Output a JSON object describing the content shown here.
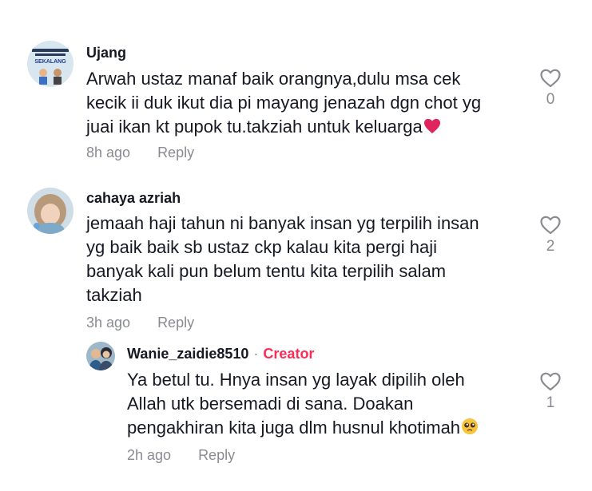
{
  "comments": [
    {
      "username": "Ujang",
      "avatar_text": [
        "SEKALANG"
      ],
      "lines": [
        "Arwah ustaz manaf baik orangnya,dulu msa cek",
        "kecik ii duk ikut dia pi mayang jenazah dgn chot yg",
        "juai ikan kt pupok tu.takziah untuk keluarga"
      ],
      "emoji": "red-heart",
      "time": "8h ago",
      "reply_label": "Reply",
      "likes": "0"
    },
    {
      "username": "cahaya azriah",
      "lines": [
        "jemaah haji tahun ni banyak insan yg terpilih insan",
        "yg baik baik sb ustaz ckp kalau kita pergi haji",
        "banyak kali pun belum tentu kita terpilih salam",
        "takziah"
      ],
      "time": "3h ago",
      "reply_label": "Reply",
      "likes": "2"
    }
  ],
  "reply": {
    "username": "Wanie_zaidie8510",
    "separator": "·",
    "creator_label": "Creator",
    "lines": [
      "Ya betul tu. Hnya insan yg layak dipilih oleh",
      "Allah utk bersemadi di sana. Doakan",
      "pengakhiran kita juga dlm husnul khotimah"
    ],
    "emoji": "pleading-face",
    "time": "2h ago",
    "reply_label": "Reply",
    "likes": "1"
  },
  "colors": {
    "text": "#161823",
    "muted": "#8a8b91",
    "creator": "#fe2c55",
    "heart": "#e0245e"
  }
}
